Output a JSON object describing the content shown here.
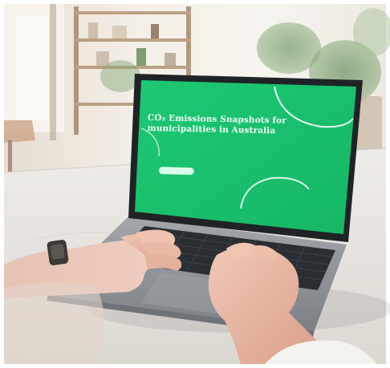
{
  "screen": {
    "brand": "",
    "title": "CO₂ Emissions Snapshots for municipalities in Australia",
    "subtitle": "",
    "cta_label": ""
  },
  "colors": {
    "screen_green": "#19c46f",
    "laptop_body": "#8d9196",
    "bezel": "#1f2326",
    "keyboard": "#2a2d31",
    "skin": "#e9b9a5",
    "table": "#ece9e4"
  }
}
